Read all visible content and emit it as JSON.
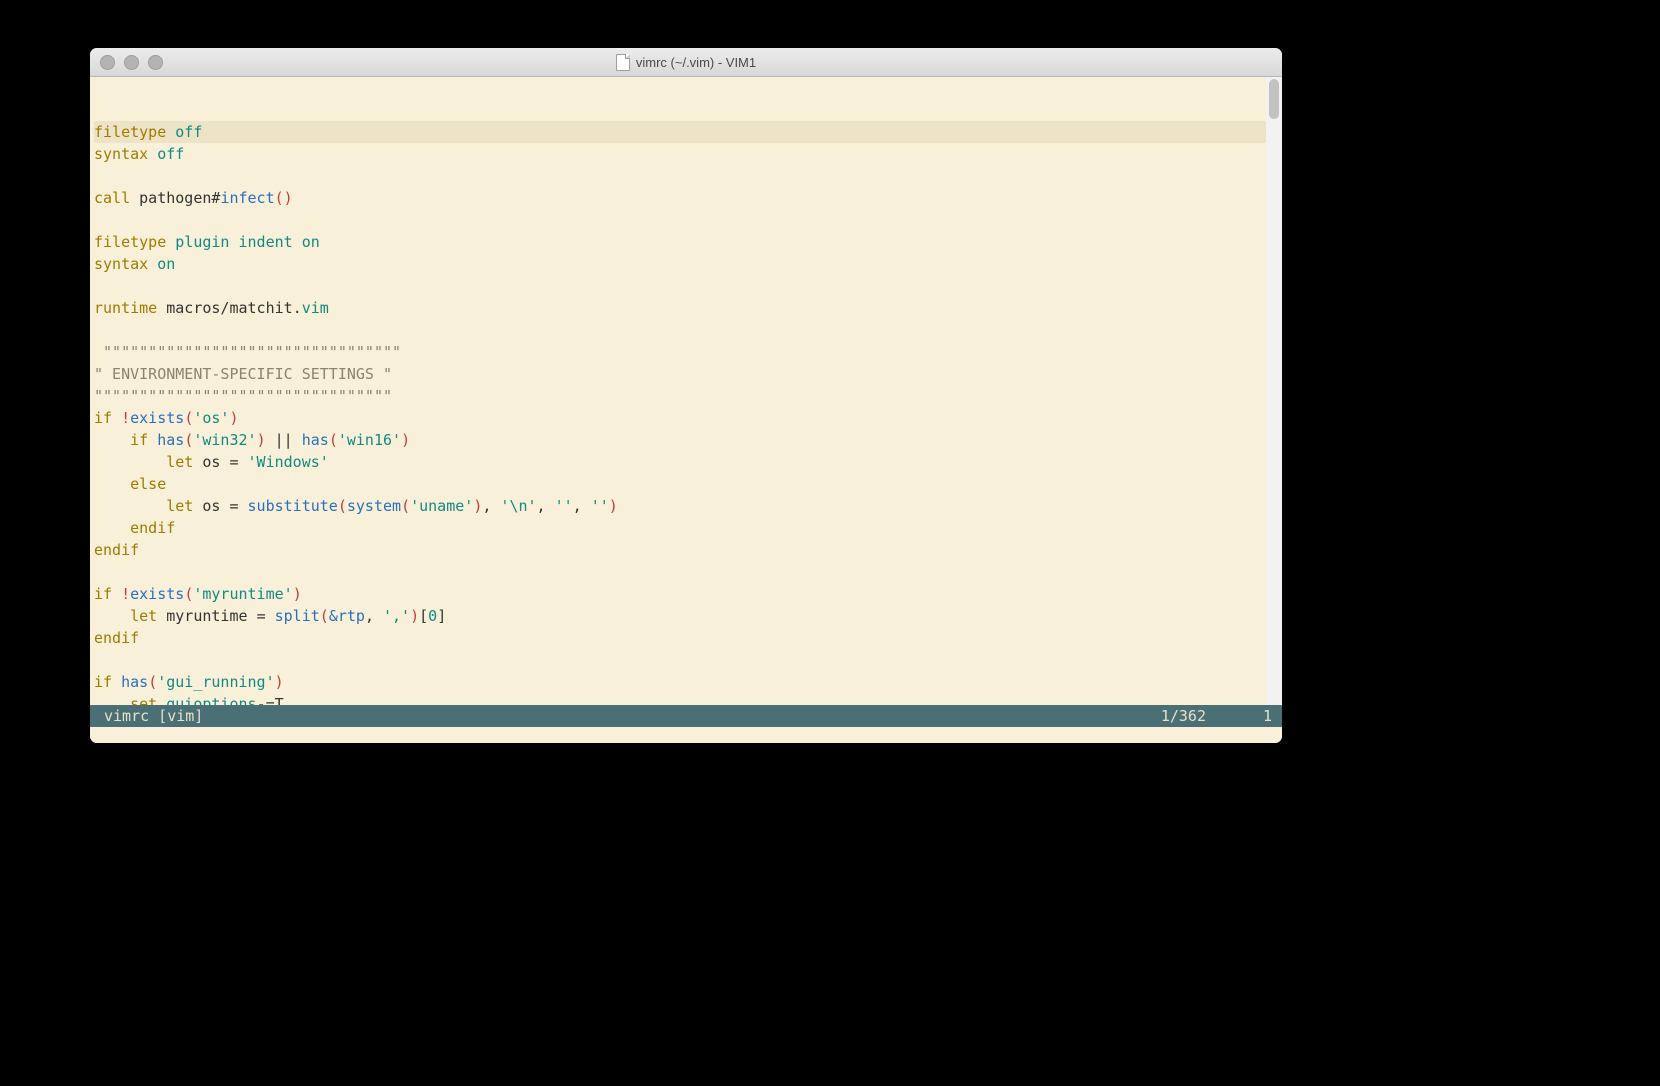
{
  "window": {
    "title": "vimrc (~/.vim) - VIM1"
  },
  "statusbar": {
    "left": " vimrc [vim]",
    "right_line": "1/362",
    "right_col": "1"
  },
  "tokens": {
    "filetype": "filetype",
    "syntax": "syntax",
    "off": "off",
    "on": "on",
    "call": "call",
    "pathogen_hash": "pathogen#",
    "infect": "infect",
    "lparen": "(",
    "rparen": ")",
    "plugin": "plugin",
    "indent": "indent",
    "runtime": "runtime",
    "macros_path": "macros/matchit",
    "dot": ".",
    "vim_ext": "vim",
    "comment_rule": " \"\"\"\"\"\"\"\"\"\"\"\"\"\"\"\"\"\"\"\"\"\"\"\"\"\"\"\"\"\"\"\"\"",
    "comment_env": "\" ENVIRONMENT-SPECIFIC SETTINGS \"",
    "comment_rule2": "\"\"\"\"\"\"\"\"\"\"\"\"\"\"\"\"\"\"\"\"\"\"\"\"\"\"\"\"\"\"\"\"\"",
    "if": "if",
    "bang": "!",
    "exists": "exists",
    "str_os": "'os'",
    "has": "has",
    "str_win32": "'win32'",
    "or": "||",
    "str_win16": "'win16'",
    "let": "let",
    "os_var": "os",
    "eq": "=",
    "str_Windows": "'Windows'",
    "else": "else",
    "substitute": "substitute",
    "system": "system",
    "str_uname": "'uname'",
    "comma": ",",
    "str_nl": "'\\n'",
    "str_empty": "''",
    "endif": "endif",
    "str_myruntime": "'myruntime'",
    "myruntime_var": "myruntime",
    "split": "split",
    "amp_rtp": "&rtp",
    "str_comma": "','",
    "lbracket": "[",
    "zero": "0",
    "rbracket": "]",
    "str_gui_running": "'gui_running'",
    "set": "set",
    "guioptions": "guioptions",
    "minus_eq": "-=",
    "T": "T"
  }
}
